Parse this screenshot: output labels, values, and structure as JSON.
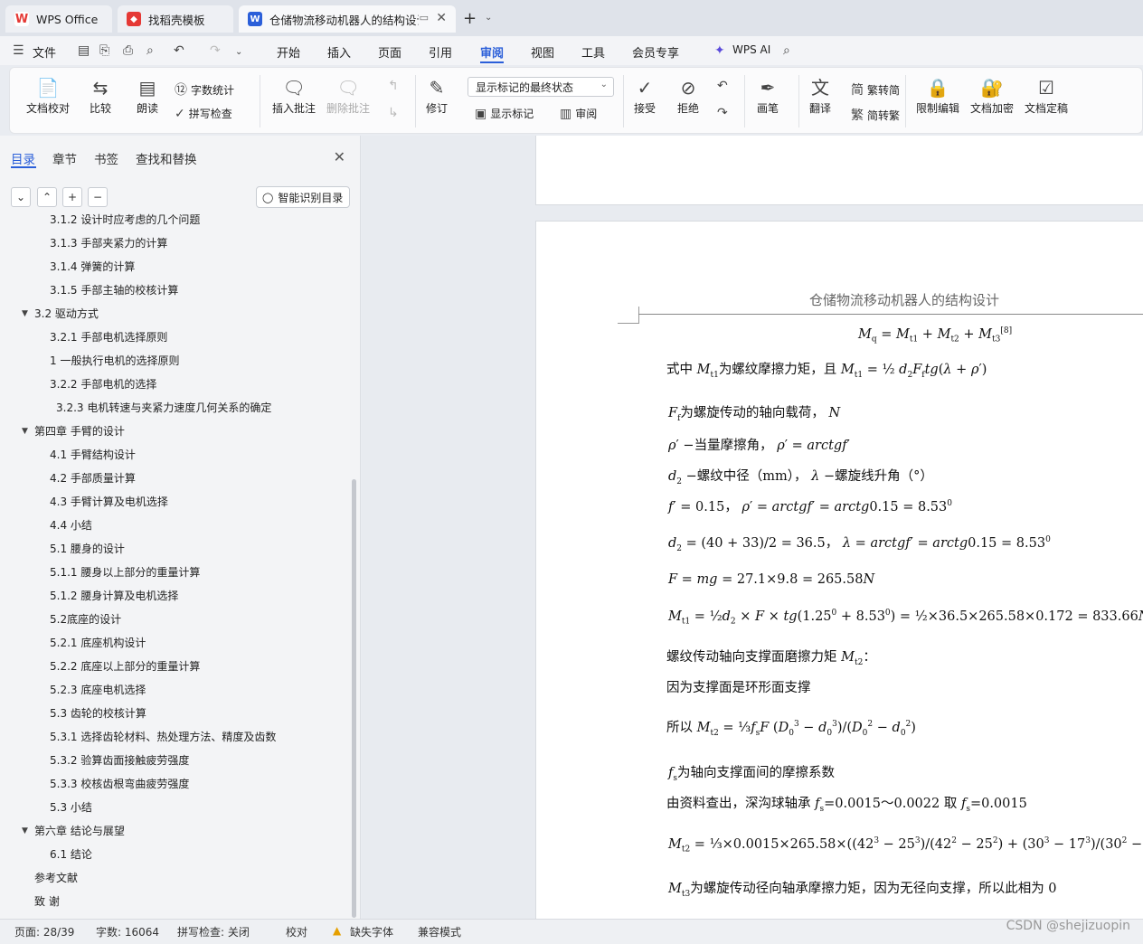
{
  "tabs": [
    {
      "label": "WPS Office"
    },
    {
      "label": "找稻壳模板"
    },
    {
      "label": "仓储物流移动机器人的结构设计"
    }
  ],
  "menu": {
    "file": "文件",
    "items": [
      "开始",
      "插入",
      "页面",
      "引用",
      "审阅",
      "视图",
      "工具",
      "会员专享"
    ],
    "active": "审阅",
    "ai": "WPS AI"
  },
  "ribbon": {
    "doc_proof": "文档校对",
    "compare": "比较",
    "read_aloud": "朗读",
    "word_count": "字数统计",
    "spell_check": "拼写检查",
    "insert_comment": "插入批注",
    "delete_comment": "删除批注",
    "track_changes": "修订",
    "markup_state": "显示标记的最终状态",
    "show_markup": "显示标记",
    "review": "审阅",
    "accept": "接受",
    "reject": "拒绝",
    "pen": "画笔",
    "translate": "翻译",
    "trad_to_simp": "繁转简",
    "simp_to_trad": "简转繁",
    "restrict_edit": "限制编辑",
    "encrypt": "文档加密",
    "finalize": "文档定稿"
  },
  "sidebar": {
    "tabs": [
      "目录",
      "章节",
      "书签",
      "查找和替换"
    ],
    "smart_toc": "智能识别目录",
    "toc": [
      {
        "text": "3.1.2  设计时应考虑的几个问题",
        "level": 3
      },
      {
        "text": "3.1.3  手部夹紧力的计算",
        "level": 3
      },
      {
        "text": "3.1.4  弹簧的计算",
        "level": 3
      },
      {
        "text": "3.1.5  手部主轴的校核计算",
        "level": 3
      },
      {
        "text": "3.2  驱动方式",
        "level": 2,
        "expanded": true
      },
      {
        "text": "3.2.1  手部电机选择原则",
        "level": 3
      },
      {
        "text": "1  一般执行电机的选择原则",
        "level": 3
      },
      {
        "text": "3.2.2  手部电机的选择",
        "level": 3
      },
      {
        "text": "3.2.3  电机转速与夹紧力速度几何关系的确定",
        "level": 4
      },
      {
        "text": "第四章   手臂的设计",
        "level": 1,
        "expanded": true
      },
      {
        "text": "4.1  手臂结构设计",
        "level": 3
      },
      {
        "text": "4.2  手部质量计算",
        "level": 3
      },
      {
        "text": "4.3  手臂计算及电机选择",
        "level": 3
      },
      {
        "text": "4.4    小结",
        "level": 3
      },
      {
        "text": "5.1  腰身的设计",
        "level": 3
      },
      {
        "text": "5.1.1  腰身以上部分的重量计算",
        "level": 3
      },
      {
        "text": "5.1.2  腰身计算及电机选择",
        "level": 3
      },
      {
        "text": "5.2底座的设计",
        "level": 3
      },
      {
        "text": "5.2.1  底座机构设计",
        "level": 3
      },
      {
        "text": "5.2.2  底座以上部分的重量计算",
        "level": 3
      },
      {
        "text": "5.2.3  底座电机选择",
        "level": 3
      },
      {
        "text": "5.3  齿轮的校核计算",
        "level": 3
      },
      {
        "text": "5.3.1  选择齿轮材料、热处理方法、精度及齿数",
        "level": 3
      },
      {
        "text": "5.3.2  验算齿面接触疲劳强度",
        "level": 3
      },
      {
        "text": "5.3.3  校核齿根弯曲疲劳强度",
        "level": 3
      },
      {
        "text": "5.3    小结",
        "level": 3
      },
      {
        "text": "第六章  结论与展望",
        "level": 1,
        "expanded": true
      },
      {
        "text": "6.1  结论",
        "level": 3
      },
      {
        "text": "参考文献",
        "level": 1
      },
      {
        "text": "致  谢",
        "level": 1
      }
    ]
  },
  "document": {
    "header": "仓储物流移动机器人的结构设计"
  },
  "status": {
    "page": "页面: 28/39",
    "word_count": "字数: 16064",
    "spell_check": "拼写检查: 关闭",
    "proof": "校对",
    "missing_font": "缺失字体",
    "compat_mode": "兼容模式"
  },
  "watermark": "CSDN @shejizuopin"
}
